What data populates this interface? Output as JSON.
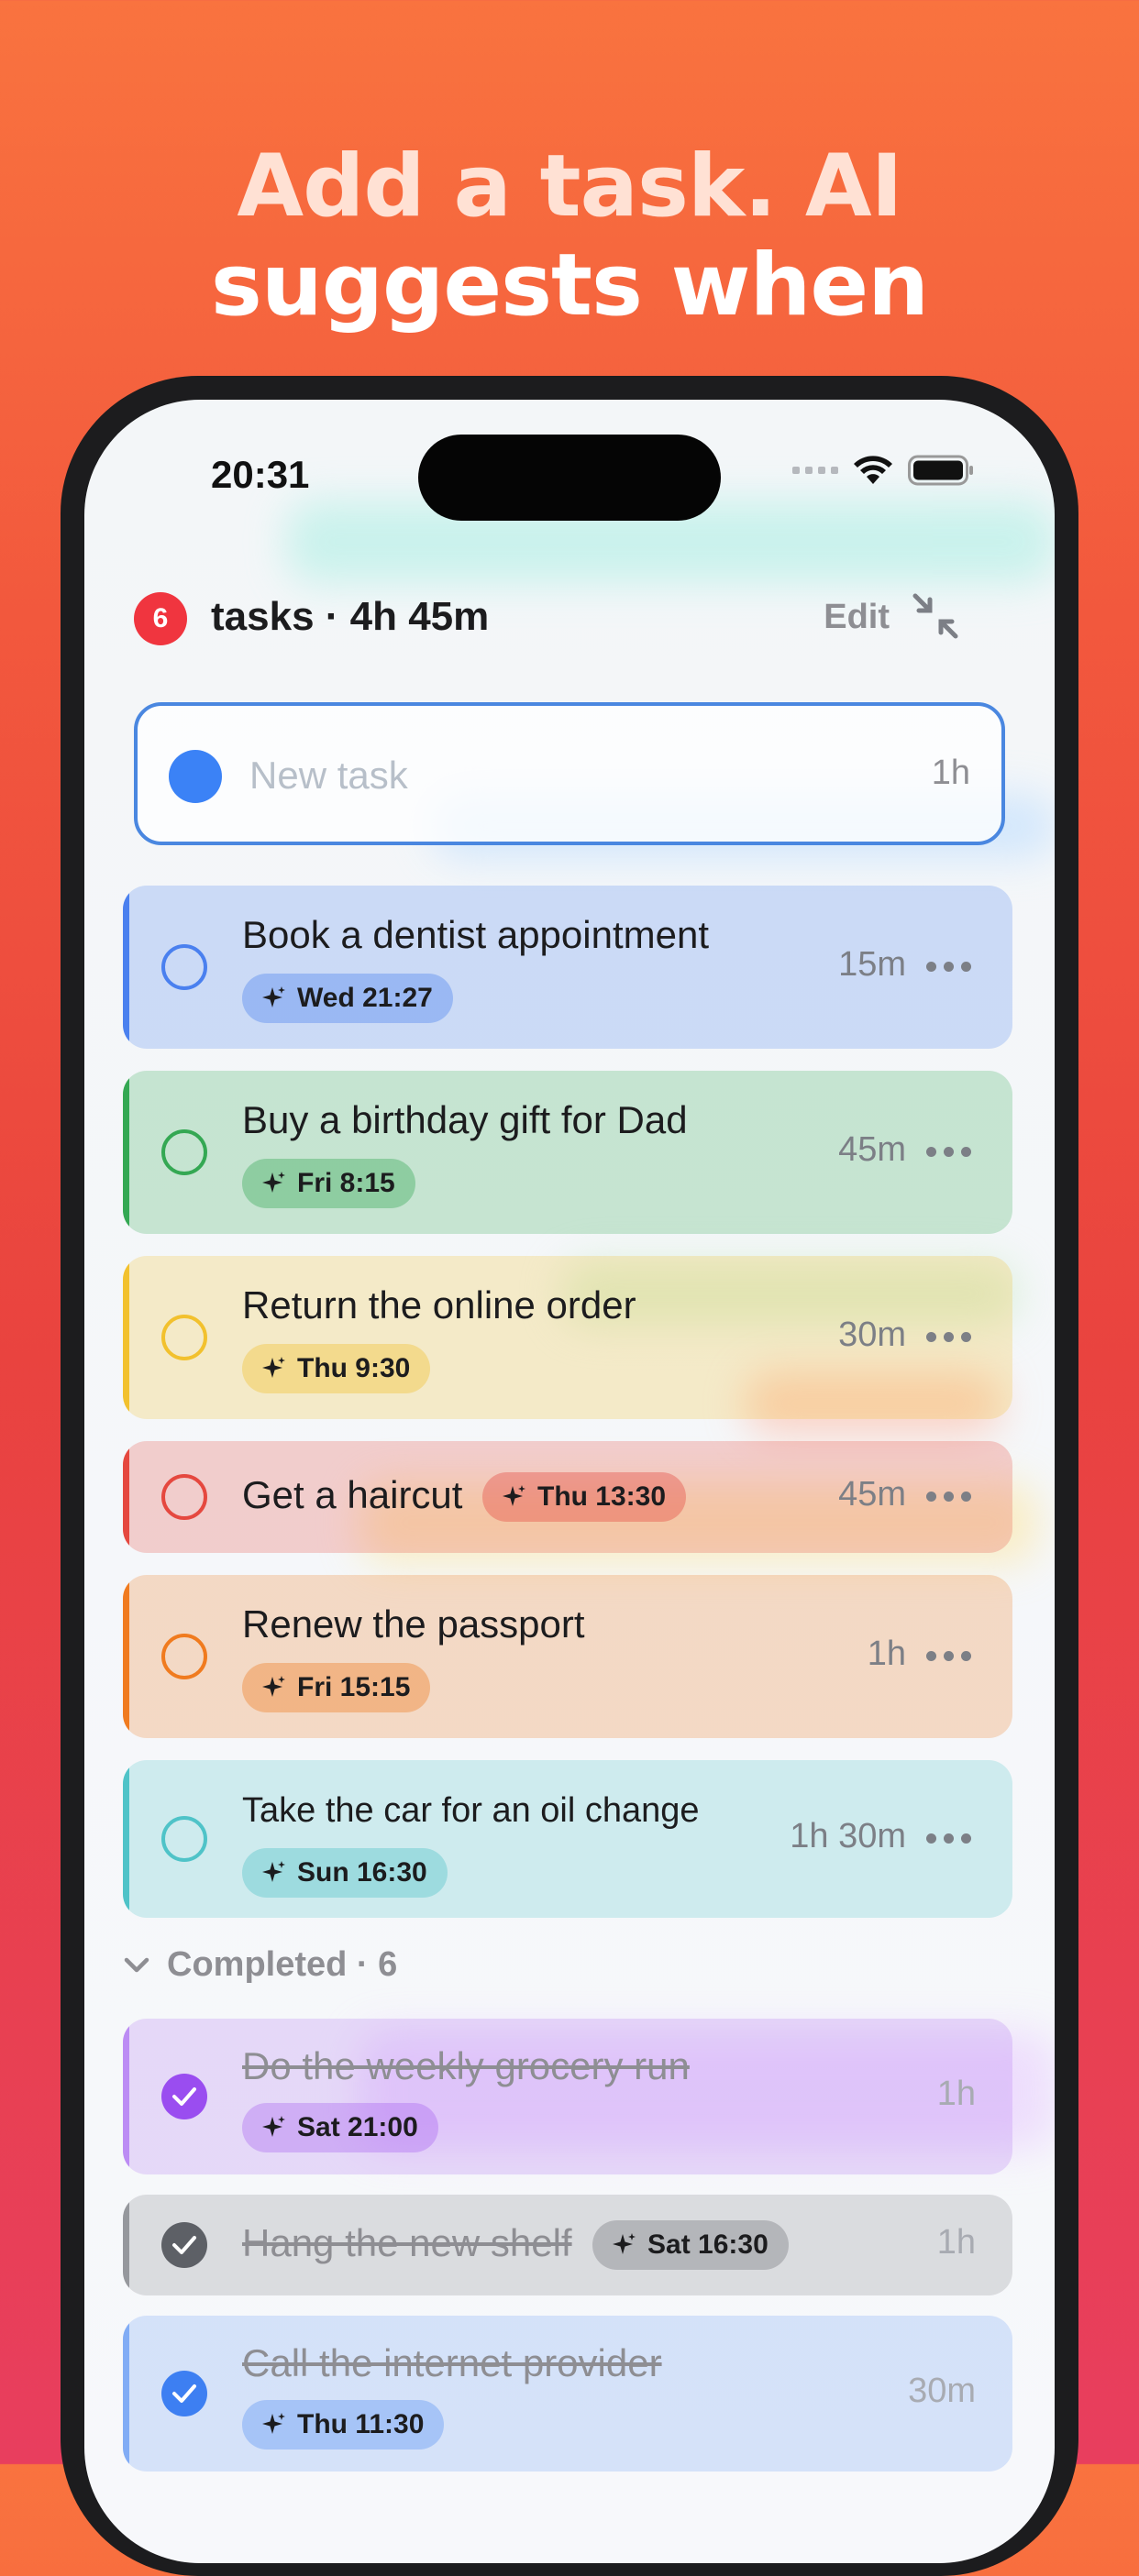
{
  "headline": {
    "line1": "Add a task. AI",
    "line2": "suggests when"
  },
  "status_bar": {
    "time": "20:31"
  },
  "header": {
    "count": "6",
    "title": "tasks · 4h 45m",
    "edit_label": "Edit"
  },
  "new_task": {
    "placeholder": "New task",
    "duration": "1h"
  },
  "tasks": [
    {
      "title": "Book a dentist appointment",
      "suggested_time": "Wed 21:27",
      "duration": "15m",
      "color": "#4a80ef"
    },
    {
      "title": "Buy a birthday gift for Dad",
      "suggested_time": "Fri 8:15",
      "duration": "45m",
      "color": "#34a853"
    },
    {
      "title": "Return the online order",
      "suggested_time": "Thu 9:30",
      "duration": "30m",
      "color": "#f2c12e"
    },
    {
      "title": "Get a haircut",
      "suggested_time": "Thu 13:30",
      "duration": "45m",
      "color": "#e5483f"
    },
    {
      "title": "Renew the passport",
      "suggested_time": "Fri 15:15",
      "duration": "1h",
      "color": "#f07b1f"
    },
    {
      "title": "Take the car for an oil change",
      "suggested_time": "Sun 16:30",
      "duration": "1h 30m",
      "color": "#4fc3c8"
    }
  ],
  "completed": {
    "label": "Completed · 6",
    "items": [
      {
        "title": "Do the weekly grocery run",
        "suggested_time": "Sat 21:00",
        "duration": "1h",
        "color": "#9a4df0"
      },
      {
        "title": "Hang the new shelf",
        "suggested_time": "Sat 16:30",
        "duration": "1h",
        "color": "#5d6066"
      },
      {
        "title": "Call the internet provider",
        "suggested_time": "Thu 11:30",
        "duration": "30m",
        "color": "#3d7ff2"
      }
    ]
  }
}
